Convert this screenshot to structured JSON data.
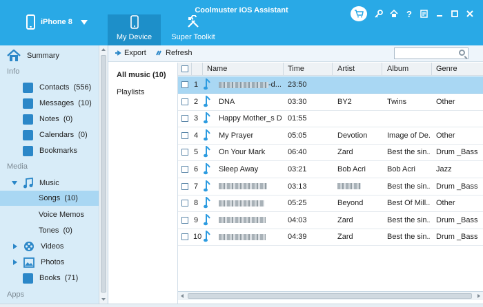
{
  "app": {
    "title": "Coolmuster iOS Assistant"
  },
  "device": {
    "name": "iPhone 8"
  },
  "tabs": [
    {
      "label": "My Device",
      "icon": "phone-icon",
      "active": true
    },
    {
      "label": "Super Toolkit",
      "icon": "tools-icon",
      "active": false
    }
  ],
  "window_controls": [
    "cart-icon",
    "key-icon",
    "home-icon",
    "help-icon",
    "feedback-icon",
    "minimize-icon",
    "maximize-icon",
    "close-icon"
  ],
  "sidebar": {
    "summary": "Summary",
    "section_info": "Info",
    "info_items": [
      {
        "label": "Contacts",
        "count": "(556)",
        "icon": "contacts-icon"
      },
      {
        "label": "Messages",
        "count": "(10)",
        "icon": "messages-icon"
      },
      {
        "label": "Notes",
        "count": "(0)",
        "icon": "notes-icon"
      },
      {
        "label": "Calendars",
        "count": "(0)",
        "icon": "calendar-icon"
      },
      {
        "label": "Bookmarks",
        "count": "",
        "icon": "bookmark-icon"
      }
    ],
    "section_media": "Media",
    "music": "Music",
    "songs": {
      "label": "Songs",
      "count": "(10)"
    },
    "voice_memos": "Voice Memos",
    "tones": {
      "label": "Tones",
      "count": "(0)"
    },
    "videos": "Videos",
    "photos": "Photos",
    "books": {
      "label": "Books",
      "count": "(71)"
    },
    "section_apps": "Apps"
  },
  "toolbar": {
    "export_label": "Export",
    "refresh_label": "Refresh",
    "search_placeholder": ""
  },
  "categories": {
    "all_music": "All music (10)",
    "playlists": "Playlists"
  },
  "table": {
    "columns": [
      "Name",
      "Time",
      "Artist",
      "Album",
      "Genre"
    ],
    "rows": [
      {
        "num": "1",
        "name": "-d...",
        "time": "23:50",
        "artist": "",
        "album": "",
        "genre": "",
        "selected": true
      },
      {
        "num": "2",
        "name": "DNA",
        "time": "03:30",
        "artist": "BY2",
        "album": "Twins",
        "genre": "Other",
        "selected": false
      },
      {
        "num": "3",
        "name": "Happy Mother_s D...",
        "time": "01:55",
        "artist": "",
        "album": "",
        "genre": "",
        "selected": false
      },
      {
        "num": "4",
        "name": "My Prayer",
        "time": "05:05",
        "artist": "Devotion",
        "album": "Image of De...",
        "genre": "Other",
        "selected": false
      },
      {
        "num": "5",
        "name": "On Your Mark",
        "time": "06:40",
        "artist": "Zard",
        "album": "Best the sin...",
        "genre": "Drum _Bass",
        "selected": false
      },
      {
        "num": "6",
        "name": "Sleep Away",
        "time": "03:21",
        "artist": "Bob Acri",
        "album": "Bob Acri",
        "genre": "Jazz",
        "selected": false
      },
      {
        "num": "7",
        "name": "",
        "time": "03:13",
        "artist": "",
        "album": "Best the sin...",
        "genre": "Drum _Bass",
        "selected": false
      },
      {
        "num": "8",
        "name": "",
        "time": "05:25",
        "artist": "Beyond",
        "album": "Best Of Mill...",
        "genre": "Other",
        "selected": false
      },
      {
        "num": "9",
        "name": "",
        "time": "04:03",
        "artist": "Zard",
        "album": "Best the sin...",
        "genre": "Drum _Bass",
        "selected": false
      },
      {
        "num": "10",
        "name": "",
        "time": "04:39",
        "artist": "Zard",
        "album": "Best the sin...",
        "genre": "Drum _Bass",
        "selected": false
      }
    ]
  },
  "colors": {
    "header_blue": "#29a9e6",
    "active_tab": "#1d8fc9",
    "selection": "#a9d7f3",
    "sidebar_bg": "#d8ecf8"
  }
}
